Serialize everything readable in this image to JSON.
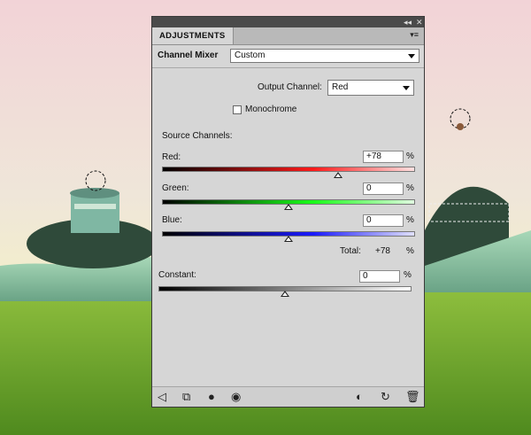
{
  "panel": {
    "title_icons": {
      "collapse": "◂◂",
      "close": "✕"
    },
    "tab_label": "ADJUSTMENTS",
    "menu_icon": "▾≡",
    "header": {
      "title": "Channel Mixer",
      "preset_value": "Custom"
    },
    "output_channel": {
      "label": "Output Channel:",
      "value": "Red"
    },
    "monochrome": {
      "label": "Monochrome",
      "checked": false
    },
    "source_channels_label": "Source Channels:",
    "channels": [
      {
        "label": "Red:",
        "value": "+78",
        "unit": "%",
        "level": 78,
        "color": "#ff2020"
      },
      {
        "label": "Green:",
        "value": "0",
        "unit": "%",
        "level": 0,
        "color": "#20ff20"
      },
      {
        "label": "Blue:",
        "value": "0",
        "unit": "%",
        "level": 0,
        "color": "#2020ff"
      }
    ],
    "total": {
      "label": "Total:",
      "value": "+78",
      "unit": "%"
    },
    "constant": {
      "label": "Constant:",
      "value": "0",
      "unit": "%",
      "level": 0
    }
  },
  "footer_icons": [
    "back-arrow-icon",
    "clip-to-layer-icon",
    "layer-mask-icon",
    "visibility-eye-icon",
    "previous-state-icon",
    "reset-icon",
    "trash-icon"
  ]
}
